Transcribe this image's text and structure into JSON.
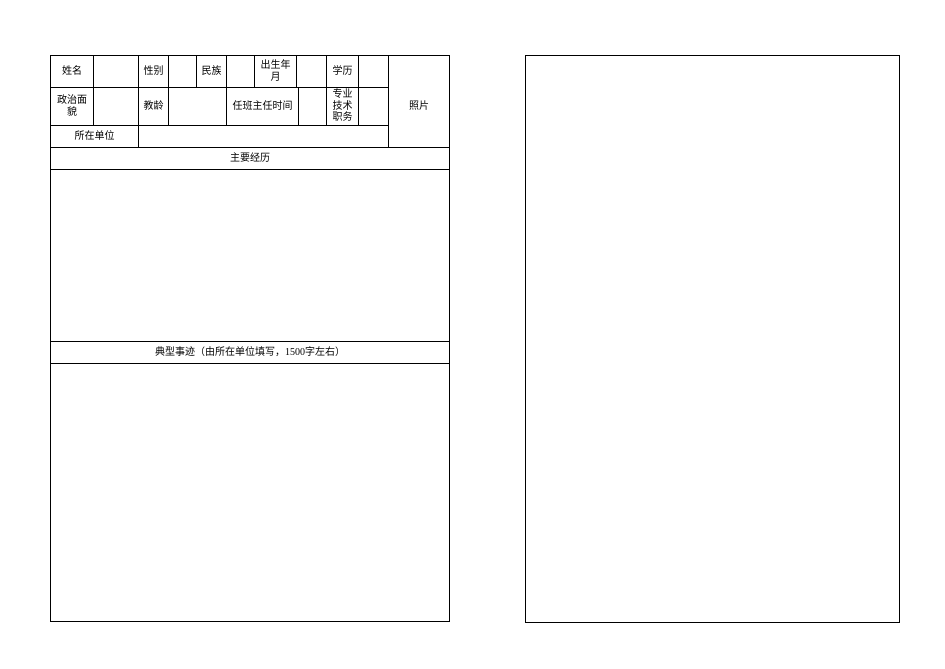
{
  "form": {
    "row1": {
      "name_label": "姓名",
      "name_value": "",
      "gender_label": "性别",
      "gender_value": "",
      "ethnicity_label": "民族",
      "ethnicity_value": "",
      "birth_label": "出生年月",
      "birth_value": "",
      "education_label": "学历",
      "education_value": "",
      "photo_label": "照片"
    },
    "row2": {
      "political_label": "政治面貌",
      "political_value": "",
      "teaching_years_label": "教龄",
      "teaching_years_value": "",
      "director_time_label": "任班主任时间",
      "director_time_value": "",
      "tech_title_label": "专业技术职务",
      "tech_title_value": ""
    },
    "row3": {
      "unit_label": "所在单位",
      "unit_value": ""
    },
    "section1": {
      "title": "主要经历",
      "content": ""
    },
    "section2": {
      "title": "典型事迹（由所在单位填写，1500字左右）",
      "content": ""
    }
  }
}
